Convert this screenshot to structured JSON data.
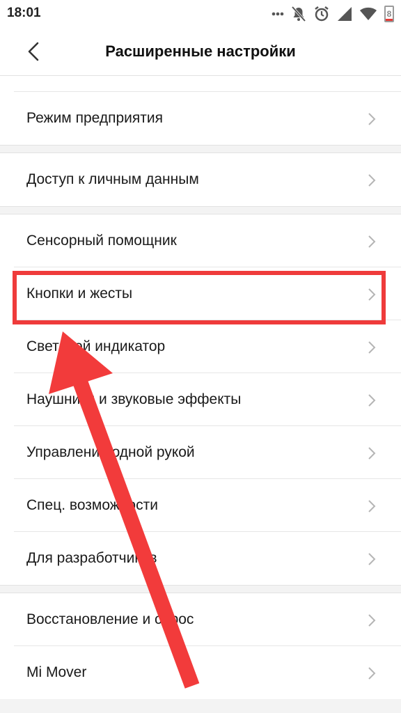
{
  "status_bar": {
    "time": "18:01",
    "battery_level": "8",
    "icons": [
      "more-dots-icon",
      "notifications-off-icon",
      "alarm-icon",
      "signal-icon",
      "wifi-icon",
      "battery-icon"
    ]
  },
  "header": {
    "title": "Расширенные настройки",
    "back_icon": "back-arrow-icon"
  },
  "groups": [
    {
      "items": [
        {
          "label": "Режим предприятия"
        }
      ]
    },
    {
      "items": [
        {
          "label": "Доступ к личным данным"
        }
      ]
    },
    {
      "items": [
        {
          "label": "Сенсорный помощник"
        },
        {
          "label": "Кнопки и жесты"
        },
        {
          "label": "Световой индикатор"
        },
        {
          "label": "Наушники и звуковые эффекты"
        },
        {
          "label": "Управление одной рукой"
        },
        {
          "label": "Спец. возможности"
        },
        {
          "label": "Для разработчиков"
        }
      ]
    },
    {
      "items": [
        {
          "label": "Восстановление и сброс"
        },
        {
          "label": "Mi Mover"
        }
      ]
    }
  ],
  "annotation": {
    "highlighted_item": "Кнопки и жесты",
    "highlight_color": "#ef3b3b",
    "arrow_color": "#f23b3b"
  },
  "colors": {
    "background": "#f3f3f3",
    "surface": "#ffffff",
    "chevron": "#b5b5b5"
  }
}
